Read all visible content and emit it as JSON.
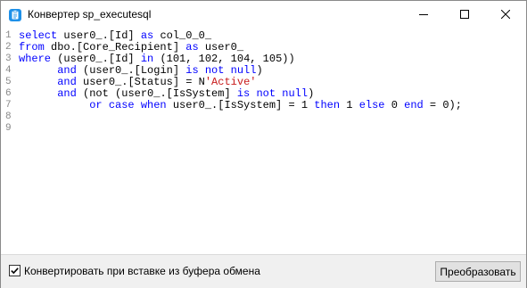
{
  "window": {
    "title": "Конвертер sp_executesql"
  },
  "editor": {
    "line_numbers": [
      "1",
      "2",
      "3",
      "4",
      "5",
      "6",
      "7",
      "8",
      "9"
    ],
    "lines": [
      [
        {
          "t": "select",
          "c": "kw"
        },
        {
          "t": " user0_.[Id] ",
          "c": ""
        },
        {
          "t": "as",
          "c": "kw"
        },
        {
          "t": " col_0_0_",
          "c": ""
        }
      ],
      [
        {
          "t": "from",
          "c": "kw"
        },
        {
          "t": " dbo.[Core_Recipient] ",
          "c": ""
        },
        {
          "t": "as",
          "c": "kw"
        },
        {
          "t": " user0_",
          "c": ""
        }
      ],
      [
        {
          "t": "where",
          "c": "kw"
        },
        {
          "t": " (user0_.[Id] ",
          "c": ""
        },
        {
          "t": "in",
          "c": "kw"
        },
        {
          "t": " (101, 102, 104, 105))",
          "c": ""
        }
      ],
      [
        {
          "t": "      ",
          "c": ""
        },
        {
          "t": "and",
          "c": "kw"
        },
        {
          "t": " (user0_.[Login] ",
          "c": ""
        },
        {
          "t": "is not null",
          "c": "kw"
        },
        {
          "t": ")",
          "c": ""
        }
      ],
      [
        {
          "t": "      ",
          "c": ""
        },
        {
          "t": "and",
          "c": "kw"
        },
        {
          "t": " user0_.[Status] = N",
          "c": ""
        },
        {
          "t": "'Active'",
          "c": "str"
        }
      ],
      [
        {
          "t": "      ",
          "c": ""
        },
        {
          "t": "and",
          "c": "kw"
        },
        {
          "t": " (not (user0_.[IsSystem] ",
          "c": ""
        },
        {
          "t": "is not null",
          "c": "kw"
        },
        {
          "t": ")",
          "c": ""
        }
      ],
      [
        {
          "t": "           ",
          "c": ""
        },
        {
          "t": "or case when",
          "c": "kw"
        },
        {
          "t": " user0_.[IsSystem] = 1 ",
          "c": ""
        },
        {
          "t": "then",
          "c": "kw"
        },
        {
          "t": " 1 ",
          "c": ""
        },
        {
          "t": "else",
          "c": "kw"
        },
        {
          "t": " 0 ",
          "c": ""
        },
        {
          "t": "end",
          "c": "kw"
        },
        {
          "t": " = 0);",
          "c": ""
        }
      ],
      [],
      []
    ]
  },
  "footer": {
    "checkbox_label": "Конвертировать при вставке из буфера обмена",
    "checkbox_checked": true,
    "convert_button": "Преобразовать"
  },
  "icons": {
    "app": "clipboard-app-icon",
    "minimize": "minimize-icon",
    "maximize": "maximize-icon",
    "close": "close-icon",
    "check": "checkmark-icon"
  },
  "colors": {
    "keyword": "#0000ff",
    "string": "#c81b1b",
    "app_icon": "#1e90e8"
  }
}
